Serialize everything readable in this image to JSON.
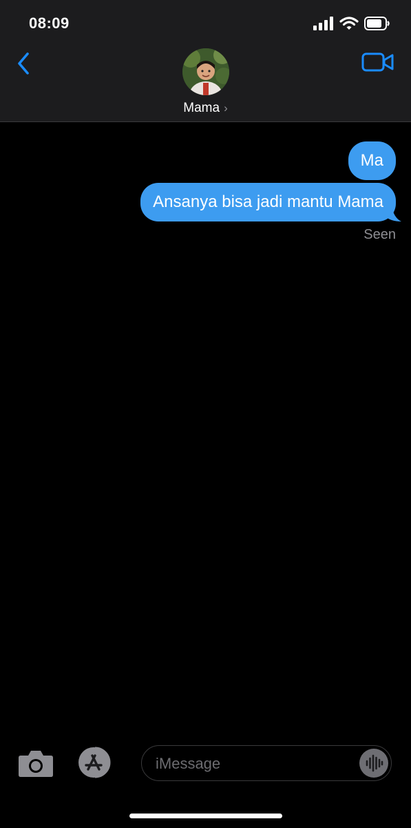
{
  "status_bar": {
    "time": "08:09"
  },
  "header": {
    "contact_name": "Mama",
    "chevron": "›"
  },
  "messages": [
    {
      "text": "Ma",
      "from": "me"
    },
    {
      "text": "Ansanya bisa jadi mantu Mama",
      "from": "me"
    }
  ],
  "receipt": "Seen",
  "composer": {
    "placeholder": "iMessage"
  },
  "colors": {
    "accent": "#3d9cf0",
    "bubble": "#3d9cf0",
    "header_bg": "#1c1c1e",
    "link": "#1a8cff"
  },
  "icons": [
    "signal-icon",
    "wifi-icon",
    "battery-icon",
    "back-chevron-icon",
    "video-camera-icon",
    "camera-icon",
    "app-store-icon",
    "audio-waveform-icon"
  ]
}
